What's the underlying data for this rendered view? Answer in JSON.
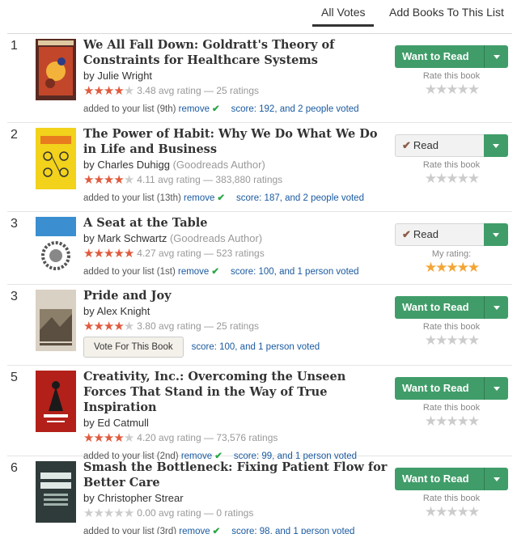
{
  "tabs": [
    {
      "label": "All Votes",
      "active": true
    },
    {
      "label": "Add Books To This List",
      "active": false
    }
  ],
  "colors": {
    "star_red": "#e05a3d",
    "star_gold": "#f3a535",
    "button_green": "#409d69",
    "link_blue": "#1a5aa0",
    "check_green": "#28a745"
  },
  "books": [
    {
      "rank": "1",
      "title": "We All Fall Down: Goldratt's Theory of Constraints for Healthcare Systems",
      "by": "by",
      "author": "Julie Wright",
      "author_note": "",
      "stars_filled": 3.5,
      "rating_text": "3.48 avg rating — 25 ratings",
      "added": "added to your list (9th)",
      "remove": "remove",
      "score_prefix": "score: 192, and",
      "voters": "2 people voted",
      "vote_button": "",
      "shelf_button": "Want to Read",
      "shelf_state": "want",
      "rate_label": "Rate this book",
      "my_rating": 0,
      "cover": {
        "text": "WE ALL FALL DOWN",
        "icon": "cover-art",
        "bg": "#5a2a22"
      }
    },
    {
      "rank": "2",
      "title": "The Power of Habit: Why We Do What We Do in Life and Business",
      "by": "by",
      "author": "Charles Duhigg",
      "author_note": "(Goodreads Author)",
      "stars_filled": 4,
      "rating_text": "4.11 avg rating — 383,880 ratings",
      "added": "added to your list (13th)",
      "remove": "remove",
      "score_prefix": "score: 187, and",
      "voters": "2 people voted",
      "vote_button": "",
      "shelf_button": "Read",
      "shelf_state": "read",
      "rate_label": "Rate this book",
      "my_rating": 0,
      "cover": {
        "text": "HABIT",
        "icon": "cover-art",
        "bg": "#f2d21b"
      }
    },
    {
      "rank": "3",
      "title": "A Seat at the Table",
      "by": "by",
      "author": "Mark Schwartz",
      "author_note": "(Goodreads Author)",
      "stars_filled": 4.5,
      "rating_text": "4.27 avg rating — 523 ratings",
      "added": "added to your list (1st)",
      "remove": "remove",
      "score_prefix": "score: 100, and",
      "voters": "1 person voted",
      "vote_button": "",
      "shelf_button": "Read",
      "shelf_state": "read",
      "rate_label": "My rating:",
      "my_rating": 5,
      "cover": {
        "text": "A Seat at the Table",
        "icon": "cover-art",
        "bg": "#ffffff"
      }
    },
    {
      "rank": "3",
      "title": "Pride and Joy",
      "by": "by",
      "author": "Alex Knight",
      "author_note": "",
      "stars_filled": 3.5,
      "rating_text": "3.80 avg rating — 25 ratings",
      "added": "",
      "remove": "",
      "score_prefix": "score: 100, and",
      "voters": "1 person voted",
      "vote_button": "Vote For This Book",
      "shelf_button": "Want to Read",
      "shelf_state": "want",
      "rate_label": "Rate this book",
      "my_rating": 0,
      "cover": {
        "text": "Pride and Joy",
        "icon": "cover-art",
        "bg": "#d9d1c3"
      }
    },
    {
      "rank": "5",
      "title": "Creativity, Inc.: Overcoming the Unseen Forces That Stand in the Way of True Inspiration",
      "by": "by",
      "author": "Ed Catmull",
      "author_note": "",
      "stars_filled": 4,
      "rating_text": "4.20 avg rating — 73,576 ratings",
      "added": "added to your list (2nd)",
      "remove": "remove",
      "score_prefix": "score: 99, and",
      "voters": "1 person voted",
      "vote_button": "",
      "shelf_button": "Want to Read",
      "shelf_state": "want",
      "rate_label": "Rate this book",
      "my_rating": 0,
      "cover": {
        "text": "CREATIVITY, INC.",
        "icon": "cover-art",
        "bg": "#b3201a"
      }
    },
    {
      "rank": "6",
      "title": "Smash the Bottleneck: Fixing Patient Flow for Better Care",
      "by": "by",
      "author": "Christopher Strear",
      "author_note": "",
      "stars_filled": 0,
      "rating_text": "0.00 avg rating — 0 ratings",
      "added": "added to your list (3rd)",
      "remove": "remove",
      "score_prefix": "score: 98, and",
      "voters": "1 person voted",
      "vote_button": "",
      "shelf_button": "Want to Read",
      "shelf_state": "want",
      "rate_label": "Rate this book",
      "my_rating": 0,
      "cover": {
        "text": "SMASH THE BOTTLENECK",
        "icon": "cover-art",
        "bg": "#2f3b3a"
      }
    }
  ]
}
